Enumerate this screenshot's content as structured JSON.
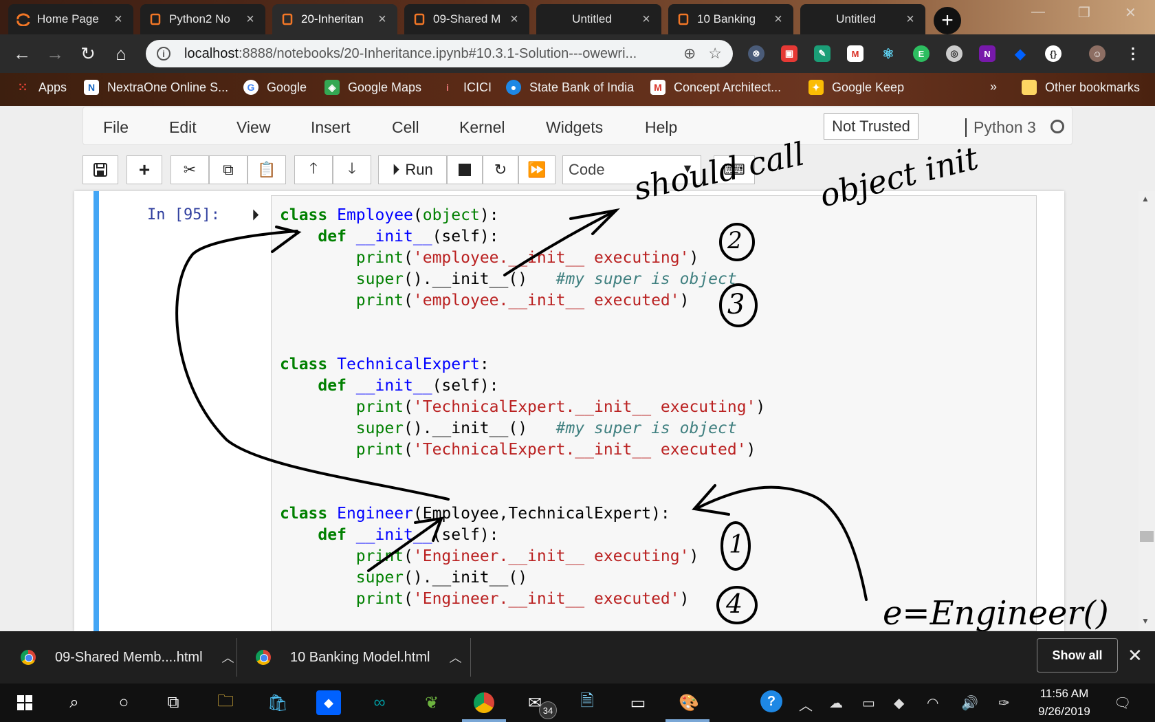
{
  "browser": {
    "tabs": [
      {
        "title": "Home Page",
        "icon": "jupyter-icon"
      },
      {
        "title": "Python2 No",
        "icon": "notebook-icon"
      },
      {
        "title": "20-Inheritan",
        "icon": "notebook-icon",
        "active": true
      },
      {
        "title": "09-Shared M",
        "icon": "notebook-icon"
      },
      {
        "title": "Untitled",
        "icon": "none"
      },
      {
        "title": "10 Banking",
        "icon": "notebook-icon"
      },
      {
        "title": "Untitled",
        "icon": "none"
      }
    ],
    "address": {
      "host": "localhost",
      "path": ":8888/notebooks/20-Inheritance.ipynb#10.3.1-Solution---owewri..."
    },
    "bookmarks": [
      {
        "label": "Apps",
        "icon": "apps-grid-icon"
      },
      {
        "label": "NextraOne Online S...",
        "icon": "nextraone-icon"
      },
      {
        "label": "Google",
        "icon": "google-icon"
      },
      {
        "label": "Google Maps",
        "icon": "maps-icon"
      },
      {
        "label": "ICICI",
        "icon": "icici-icon"
      },
      {
        "label": "State Bank of India",
        "icon": "sbi-icon"
      },
      {
        "label": "Concept Architect...",
        "icon": "gmail-icon"
      },
      {
        "label": "Google Keep",
        "icon": "keep-icon"
      },
      {
        "label": "»",
        "icon": "none"
      },
      {
        "label": "Other bookmarks",
        "icon": "folder-icon"
      }
    ]
  },
  "jupyter": {
    "menu": [
      "File",
      "Edit",
      "View",
      "Insert",
      "Cell",
      "Kernel",
      "Widgets",
      "Help"
    ],
    "trust": "Not Trusted",
    "kernel": "Python 3",
    "toolbar": {
      "run_label": "Run",
      "cell_type": "Code"
    },
    "cell": {
      "prompt": "In [95]:"
    }
  },
  "annotations": {
    "top": [
      "should call",
      "object init"
    ],
    "bottom": "e=Engineer()",
    "circled_numbers": [
      "2",
      "3",
      "1",
      "4"
    ]
  },
  "downloads": {
    "items": [
      "09-Shared Memb....html",
      "10 Banking Model.html"
    ],
    "show_all": "Show all"
  },
  "taskbar": {
    "time": "11:56 AM",
    "date": "9/26/2019",
    "mail_badge": "34"
  },
  "colors": {
    "cell_selected_bar": "#42a5f5",
    "keyword": "#008000",
    "class_name": "#0000ff",
    "string": "#ba2121",
    "comment": "#408080"
  }
}
